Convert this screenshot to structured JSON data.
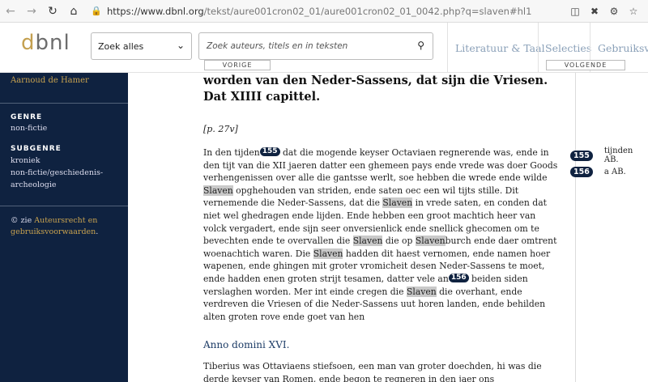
{
  "browser": {
    "url_main": "https://www.dbnl.org",
    "url_rest": "/tekst/aure001cron02_01/aure001cron02_01_0042.php?q=slaven#hl1"
  },
  "header": {
    "logo": "dbnl",
    "select_value": "Zoek alles",
    "search_placeholder": "Zoek auteurs, titels en in teksten",
    "nav_items": [
      "Literatuur & Taal",
      "Selecties",
      "Gebruiksvo"
    ],
    "prev_label": "VORIGE",
    "next_label": "VOLGENDE"
  },
  "sidebar": {
    "author": "Aarnoud de Hamer",
    "genre_heading": "GENRE",
    "genre_value": "non-fictie",
    "subgenre_heading": "SUBGENRE",
    "subgenre_lines": [
      "kroniek",
      "non-fictie/geschiedenis-",
      "archeologie"
    ],
    "copyright_prefix": "© zie ",
    "copyright_link_1": "Auteursrecht en",
    "copyright_link_2": "gebruiksvoorwaarden",
    "copyright_suffix": "."
  },
  "content": {
    "title_line1": "worden van den Neder-Sassens, dat sijn die Vriesen.",
    "title_line2": "Dat XIIII capittel.",
    "page_ref": "[p. 27v]",
    "para1": [
      {
        "t": "In den tijden"
      },
      {
        "n": "155"
      },
      {
        "t": " dat die mogende keyser Octaviaen regnerende was, ende in den tijt van die XII jaeren datter een ghemeen pays ende vrede was doer Goods verhengenissen over alle die gantsse werlt, soe hebben die wrede ende wilde "
      },
      {
        "h": "Slaven"
      },
      {
        "t": " opghehouden van striden, ende saten oec een wil tijts stille. Dit vernemende die Neder-Sassens, dat die "
      },
      {
        "h": "Slaven"
      },
      {
        "t": " in vrede saten, en conden dat niet wel ghedragen ende lijden. Ende hebben een groot machtich heer van volck vergadert, ende sijn seer onversienlick ende snellick ghecomen om te bevechten ende te overvallen die "
      },
      {
        "h": "Slaven"
      },
      {
        "t": " die op "
      },
      {
        "h": "Slaven"
      },
      {
        "t": "burch ende daer omtrent woenachtich waren. Die "
      },
      {
        "h": "Slaven"
      },
      {
        "t": " hadden dit haest vernomen, ende namen hoer wapenen, ende ghingen mit groter vromicheit desen Neder-Sassens te moet, ende hadden enen groten strijt tesamen, datter vele an"
      },
      {
        "n": "156"
      },
      {
        "t": " beiden siden verslaghen worden. Mer int einde cregen die "
      },
      {
        "h": "Slaven"
      },
      {
        "t": " die overhant, ende verdreven die Vriesen of die Neder-Sassens uut horen landen, ende behilden alten groten rove ende goet van hen"
      }
    ],
    "section_heading": "Anno domini XVI.",
    "para2": "Tiberius was Ottaviaens stiefsoen, een man van groter doechden, hi was die derde keyser van Romen, ende begon te regneren in den jaer ons"
  },
  "footnotes": [
    {
      "num": "155",
      "text": "tijnden AB."
    },
    {
      "num": "156",
      "text": "a AB."
    }
  ]
}
